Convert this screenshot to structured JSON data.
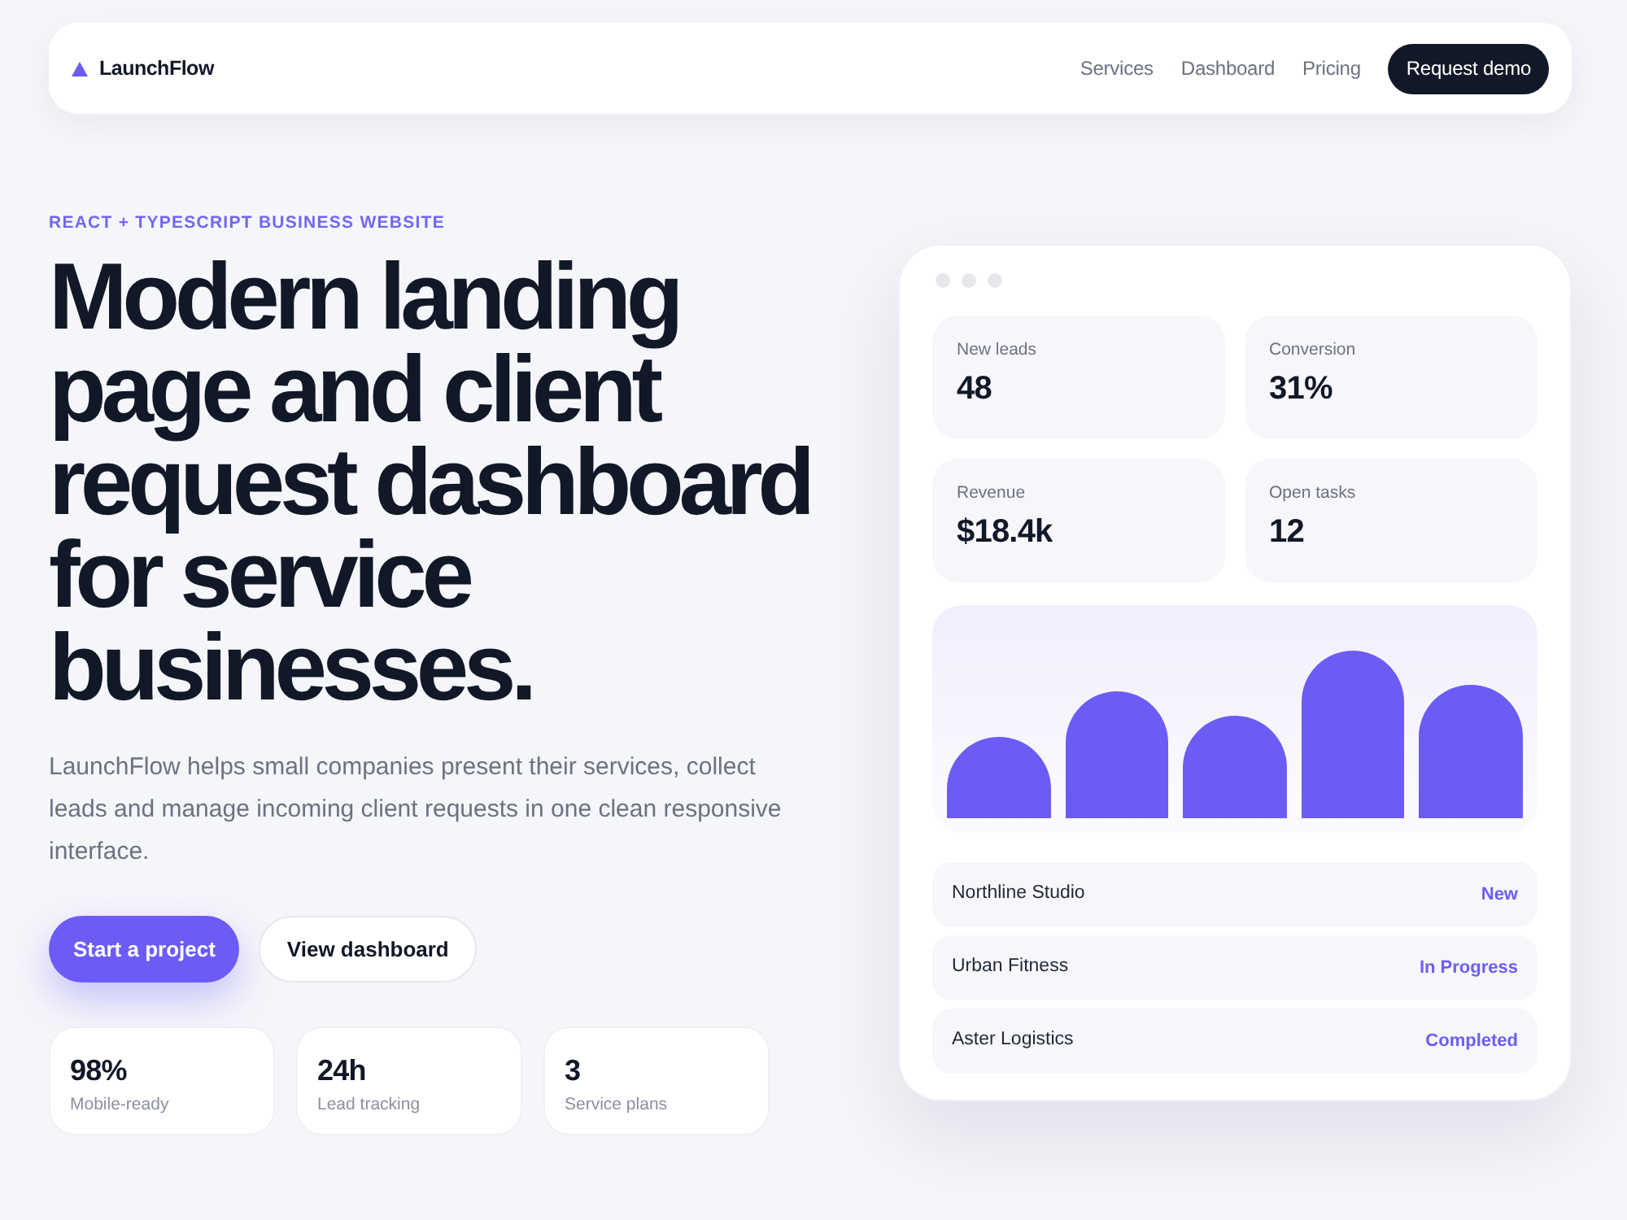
{
  "nav": {
    "logo": "LaunchFlow",
    "links": [
      "Services",
      "Dashboard",
      "Pricing"
    ],
    "cta": "Request demo"
  },
  "hero": {
    "eyebrow": "REACT + TYPESCRIPT BUSINESS WEBSITE",
    "headline": "Modern landing page and client request dashboard for service businesses.",
    "description": "LaunchFlow helps small companies present their services, collect leads and manage incoming client requests in one clean responsive interface.",
    "buttons": [
      {
        "label": "Start a project",
        "kind": "primary"
      },
      {
        "label": "View dashboard",
        "kind": "secondary"
      }
    ],
    "stats": [
      {
        "value": "98%",
        "label": "Mobile-ready"
      },
      {
        "value": "24h",
        "label": "Lead tracking"
      },
      {
        "value": "3",
        "label": "Service plans"
      }
    ]
  },
  "dashboard": {
    "metrics": [
      {
        "label": "New leads",
        "value": "48"
      },
      {
        "label": "Conversion",
        "value": "31%"
      },
      {
        "label": "Revenue",
        "value": "$18.4k"
      },
      {
        "label": "Open tasks",
        "value": "12"
      }
    ],
    "requests": [
      {
        "client": "Northline Studio",
        "status": "New"
      },
      {
        "client": "Urban Fitness",
        "status": "In Progress"
      },
      {
        "client": "Aster Logistics",
        "status": "Completed"
      }
    ]
  }
}
